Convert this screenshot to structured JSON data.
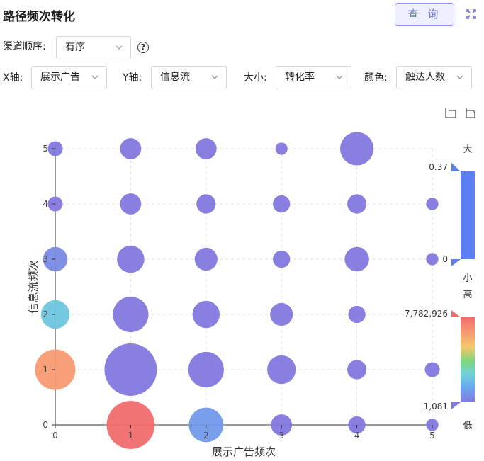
{
  "header": {
    "title": "路径频次转化",
    "query_label": "查 询"
  },
  "controls": {
    "channel_order": {
      "label": "渠道顺序:",
      "value": "有序"
    },
    "x_axis": {
      "label": "X轴:",
      "value": "展示广告"
    },
    "y_axis": {
      "label": "Y轴:",
      "value": "信息流"
    },
    "size": {
      "label": "大小:",
      "value": "转化率"
    },
    "color": {
      "label": "颜色:",
      "value": "触达人数"
    }
  },
  "icons": {
    "query_help": "help-circle-icon",
    "expand": "expand-icon",
    "zoom": "crop-icon",
    "reset": "undo-icon"
  },
  "chart_data": {
    "type": "scatter",
    "xlabel": "展示广告频次",
    "ylabel": "信息流频次",
    "x_ticks": [
      0,
      1,
      2,
      3,
      4,
      5
    ],
    "y_ticks": [
      0,
      1,
      2,
      3,
      4,
      5
    ],
    "xlim": [
      0,
      5
    ],
    "ylim": [
      0,
      5
    ],
    "grid": true,
    "points": [
      {
        "x": 0,
        "y": 5,
        "size": 0.03,
        "color_value": 1081
      },
      {
        "x": 1,
        "y": 5,
        "size": 0.06,
        "color_value": 1081
      },
      {
        "x": 2,
        "y": 5,
        "size": 0.06,
        "color_value": 1081
      },
      {
        "x": 3,
        "y": 5,
        "size": 0.02,
        "color_value": 1081
      },
      {
        "x": 4,
        "y": 5,
        "size": 0.15,
        "color_value": 1081
      },
      {
        "x": 0,
        "y": 4,
        "size": 0.03,
        "color_value": 1081
      },
      {
        "x": 1,
        "y": 4,
        "size": 0.06,
        "color_value": 1081
      },
      {
        "x": 2,
        "y": 4,
        "size": 0.05,
        "color_value": 1081
      },
      {
        "x": 3,
        "y": 4,
        "size": 0.04,
        "color_value": 1081
      },
      {
        "x": 4,
        "y": 4,
        "size": 0.05,
        "color_value": 1081
      },
      {
        "x": 5,
        "y": 4,
        "size": 0.02,
        "color_value": 1081
      },
      {
        "x": 0,
        "y": 3,
        "size": 0.08,
        "color_value": 500000
      },
      {
        "x": 1,
        "y": 3,
        "size": 0.1,
        "color_value": 1081
      },
      {
        "x": 2,
        "y": 3,
        "size": 0.07,
        "color_value": 1081
      },
      {
        "x": 3,
        "y": 3,
        "size": 0.04,
        "color_value": 1081
      },
      {
        "x": 4,
        "y": 3,
        "size": 0.08,
        "color_value": 1081
      },
      {
        "x": 5,
        "y": 3,
        "size": 0.02,
        "color_value": 1081
      },
      {
        "x": 0,
        "y": 2,
        "size": 0.11,
        "color_value": 2200000
      },
      {
        "x": 1,
        "y": 2,
        "size": 0.17,
        "color_value": 1081
      },
      {
        "x": 2,
        "y": 2,
        "size": 0.1,
        "color_value": 1081
      },
      {
        "x": 3,
        "y": 2,
        "size": 0.07,
        "color_value": 1081
      },
      {
        "x": 4,
        "y": 2,
        "size": 0.04,
        "color_value": 1081
      },
      {
        "x": 0,
        "y": 1,
        "size": 0.22,
        "color_value": 6500000
      },
      {
        "x": 1,
        "y": 1,
        "size": 0.37,
        "color_value": 1081
      },
      {
        "x": 2,
        "y": 1,
        "size": 0.17,
        "color_value": 1081
      },
      {
        "x": 3,
        "y": 1,
        "size": 0.11,
        "color_value": 1081
      },
      {
        "x": 4,
        "y": 1,
        "size": 0.05,
        "color_value": 1081
      },
      {
        "x": 5,
        "y": 1,
        "size": 0.03,
        "color_value": 1081
      },
      {
        "x": 1,
        "y": 0,
        "size": 0.31,
        "color_value": 7782926
      },
      {
        "x": 2,
        "y": 0,
        "size": 0.16,
        "color_value": 900000
      },
      {
        "x": 3,
        "y": 0,
        "size": 0.06,
        "color_value": 1081
      },
      {
        "x": 4,
        "y": 0,
        "size": 0.04,
        "color_value": 1081
      },
      {
        "x": 5,
        "y": 0,
        "size": 0.02,
        "color_value": 1081
      }
    ],
    "size_legend": {
      "max_label": "大",
      "min_label": "小",
      "max_value": "0.37",
      "min_value": "0",
      "color": "#5b7ef0"
    },
    "color_legend": {
      "max_label": "高",
      "min_label": "低",
      "max_value": "7,782,926",
      "min_value": "1,081",
      "colors": [
        "#f06b6b",
        "#f59b72",
        "#f4c96a",
        "#7dd67d",
        "#6fd3d6",
        "#6aa8f0",
        "#8378de"
      ]
    }
  }
}
